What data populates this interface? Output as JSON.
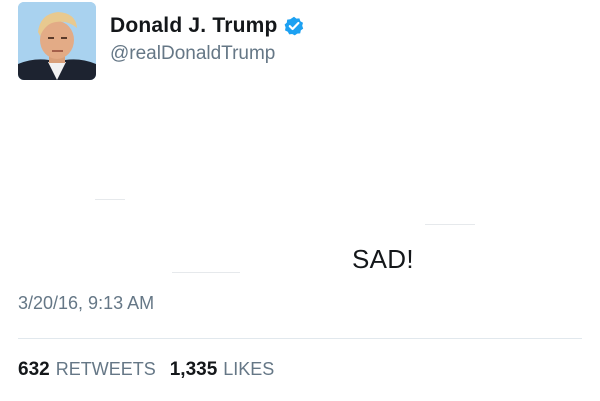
{
  "user": {
    "display_name": "Donald J. Trump",
    "handle": "@realDonaldTrump",
    "verified": true,
    "avatar_icon": "profile-photo",
    "verified_color": "#1da1f2"
  },
  "tweet": {
    "text": "SAD!",
    "timestamp": "3/20/16, 9:13 AM"
  },
  "stats": {
    "retweets_count": "632",
    "retweets_label": "RETWEETS",
    "likes_count": "1,335",
    "likes_label": "LIKES"
  }
}
